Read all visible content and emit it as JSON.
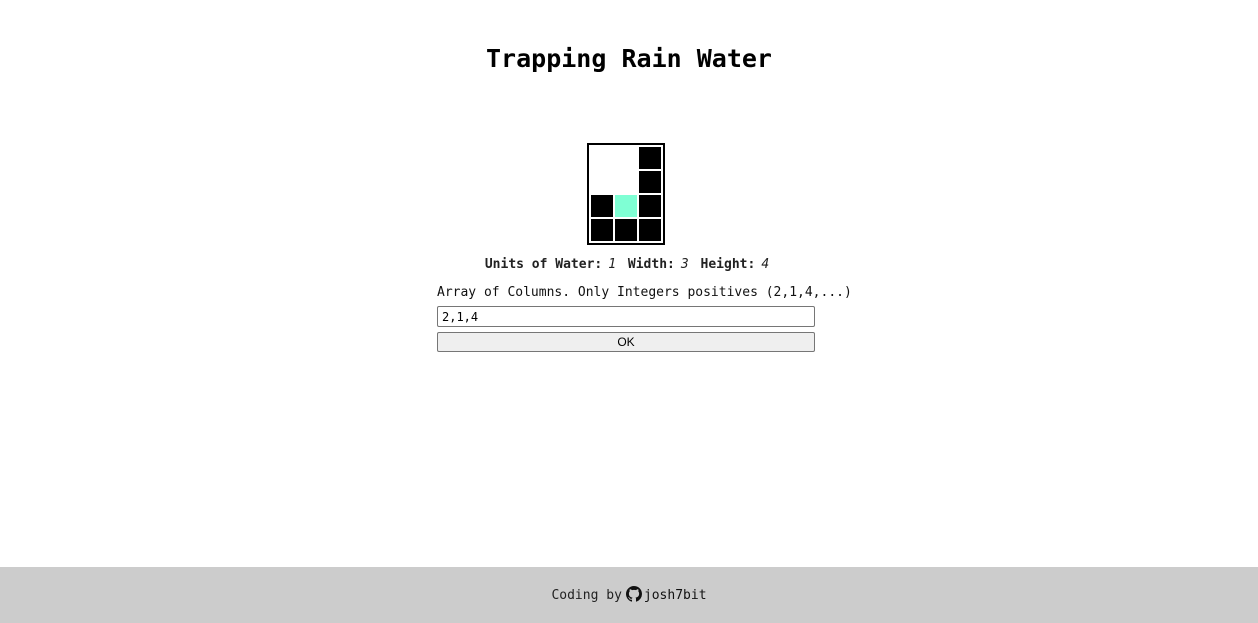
{
  "title": "Trapping Rain Water",
  "columns": [
    2,
    1,
    4
  ],
  "water_color": "#7fffd4",
  "block_color": "#000000",
  "stats": {
    "water_label": "Units of Water:",
    "water_value": "1",
    "width_label": "Width:",
    "width_value": "3",
    "height_label": "Height:",
    "height_value": "4"
  },
  "form": {
    "label": "Array of Columns. Only Integers positives (2,1,4,...)",
    "input_value": "2,1,4",
    "ok_label": "OK"
  },
  "footer": {
    "prefix": "Coding by",
    "icon": "github-icon",
    "author": "josh7bit"
  }
}
